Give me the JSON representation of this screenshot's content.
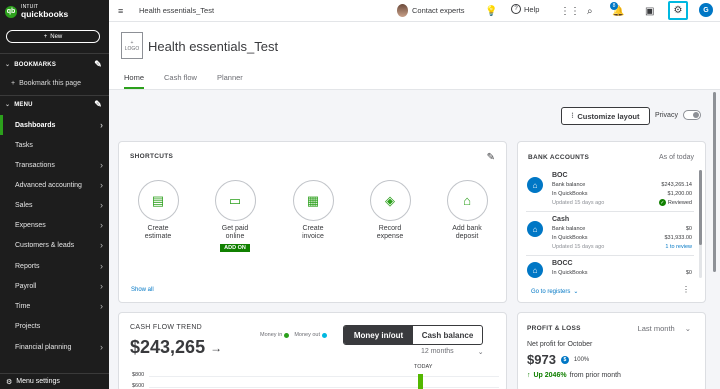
{
  "sidebar": {
    "logo_small": "INTUIT",
    "logo_big": "quickbooks",
    "new_label": "New",
    "bookmarks_label": "BOOKMARKS",
    "bookmark_page_label": "Bookmark this page",
    "menu_label": "MENU",
    "items": [
      {
        "label": "Dashboards",
        "active": true,
        "chevron": true
      },
      {
        "label": "Tasks",
        "active": false,
        "chevron": false
      },
      {
        "label": "Transactions",
        "active": false,
        "chevron": true
      },
      {
        "label": "Advanced accounting",
        "active": false,
        "chevron": true
      },
      {
        "label": "Sales",
        "active": false,
        "chevron": true
      },
      {
        "label": "Expenses",
        "active": false,
        "chevron": true
      },
      {
        "label": "Customers & leads",
        "active": false,
        "chevron": true
      },
      {
        "label": "Reports",
        "active": false,
        "chevron": true
      },
      {
        "label": "Payroll",
        "active": false,
        "chevron": true
      },
      {
        "label": "Time",
        "active": false,
        "chevron": true
      },
      {
        "label": "Projects",
        "active": false,
        "chevron": false
      },
      {
        "label": "Financial planning",
        "active": false,
        "chevron": true
      }
    ],
    "menu_settings_label": "Menu settings"
  },
  "topbar": {
    "company_title": "Health essentials_Test",
    "contact_label": "Contact experts",
    "help_label": "Help",
    "notification_count": "8",
    "user_initial": "G"
  },
  "header": {
    "logo_placeholder": "LOGO",
    "company_name": "Health essentials_Test",
    "tabs": [
      "Home",
      "Cash flow",
      "Planner"
    ]
  },
  "toolbar": {
    "customize_label": "Customize layout",
    "privacy_label": "Privacy"
  },
  "shortcuts": {
    "title": "SHORTCUTS",
    "items": [
      {
        "label_line1": "Create",
        "label_line2": "estimate",
        "icon": "estimate-icon",
        "glyph": "▤"
      },
      {
        "label_line1": "Get paid",
        "label_line2": "online",
        "icon": "get-paid-icon",
        "glyph": "▭"
      },
      {
        "label_line1": "Create",
        "label_line2": "invoice",
        "icon": "invoice-icon",
        "glyph": "▦"
      },
      {
        "label_line1": "Record",
        "label_line2": "expense",
        "icon": "expense-icon",
        "glyph": "◈"
      },
      {
        "label_line1": "Add bank",
        "label_line2": "deposit",
        "icon": "bank-deposit-icon",
        "glyph": "⌂"
      }
    ],
    "add_on_label": "ADD ON",
    "show_all_label": "Show all"
  },
  "bank_accounts": {
    "title": "BANK ACCOUNTS",
    "as_of": "As of today",
    "accounts": [
      {
        "name": "BOC",
        "bank_balance_label": "Bank balance",
        "bank_balance": "$243,265.14",
        "qb_label": "In QuickBooks",
        "qb_balance": "$1,200.00",
        "updated": "Updated 15 days ago",
        "status": "Reviewed"
      },
      {
        "name": "Cash",
        "bank_balance_label": "Bank balance",
        "bank_balance": "$0",
        "qb_label": "In QuickBooks",
        "qb_balance": "$31,933.00",
        "updated": "Updated 15 days ago",
        "status": "1 to review"
      },
      {
        "name": "BOCC",
        "bank_balance_label": "In QuickBooks",
        "bank_balance": "$0"
      }
    ],
    "goto_label": "Go to registers"
  },
  "cash_flow": {
    "title": "CASH FLOW TREND",
    "money_in_label": "Money in",
    "money_out_label": "Money out",
    "toggle_left": "Money in/out",
    "toggle_right": "Cash balance",
    "total": "$243,265",
    "period": "12 months",
    "today_label": "TODAY",
    "axis_ticks": [
      "$800",
      "$600"
    ],
    "colors": {
      "money_in": "#2ca01c",
      "money_out": "#00b8e0"
    }
  },
  "profit_loss": {
    "title": "PROFIT & LOSS",
    "period": "Last month",
    "net_label": "Net profit for October",
    "net_value": "$973",
    "percent": "100%",
    "change_value": "Up 2046%",
    "change_suffix": "from prior month"
  }
}
